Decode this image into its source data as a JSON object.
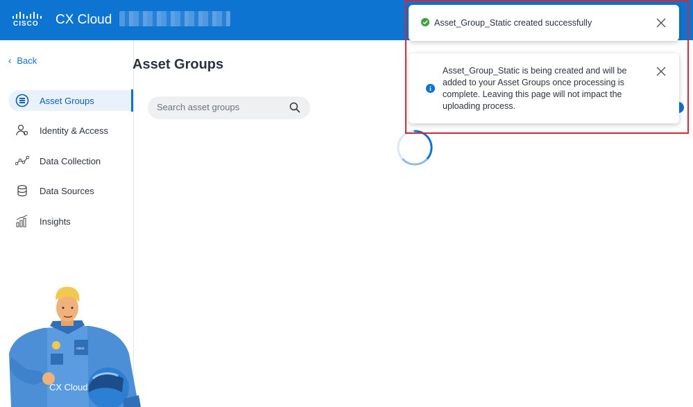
{
  "header": {
    "logo_text": "CISCO",
    "app_title": "CX Cloud"
  },
  "sidebar": {
    "back_label": "Back",
    "items": [
      {
        "label": "Asset Groups",
        "icon": "asset-groups-icon",
        "active": true
      },
      {
        "label": "Identity & Access",
        "icon": "identity-icon",
        "active": false
      },
      {
        "label": "Data Collection",
        "icon": "data-collection-icon",
        "active": false
      },
      {
        "label": "Data Sources",
        "icon": "database-icon",
        "active": false
      },
      {
        "label": "Insights",
        "icon": "insights-chart-icon",
        "active": false
      }
    ],
    "mascot_label": "CX Cloud"
  },
  "main": {
    "title": "Asset Groups",
    "search": {
      "placeholder": "Search asset groups",
      "value": ""
    }
  },
  "toasts": {
    "success": {
      "message": "Asset_Group_Static created successfully",
      "icon": "check-circle-icon"
    },
    "info": {
      "message": "Asset_Group_Static is being created and will be added to your Asset Groups once processing is complete. Leaving this page will not impact the uploading process.",
      "icon": "info-icon"
    }
  },
  "colors": {
    "brand": "#0d74d1",
    "success": "#3aa335",
    "highlight": "#cf2a36"
  }
}
